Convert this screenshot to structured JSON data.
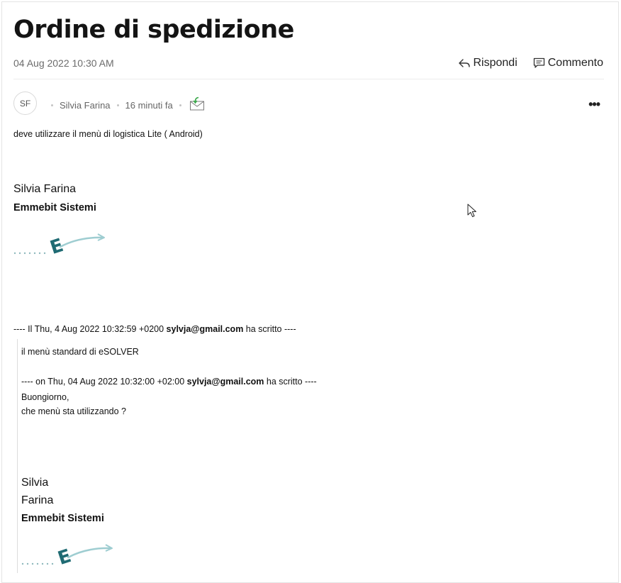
{
  "ticket": {
    "title": "Ordine di spedizione",
    "date": "04 Aug 2022 10:30 AM",
    "actions": {
      "reply": "Rispondi",
      "comment": "Commento"
    }
  },
  "message": {
    "avatar_initials": "SF",
    "author": "Silvia Farina",
    "time_ago": "16 minuti fa",
    "channel_icon": "email-incoming-icon",
    "more_label": "•••",
    "body": "deve utilizzare il menù di logistica Lite ( Android)",
    "signature": {
      "name": "Silvia Farina",
      "company": "Emmebit Sistemi",
      "logo_letter": "E"
    },
    "quote1": {
      "header_prefix": "---- Il  Thu, 4 Aug 2022 10:32:59 +0200 ",
      "email": "sylvja@gmail.com",
      "header_suffix": "  ha scritto ----",
      "body": "il menù standard di eSOLVER",
      "quote2": {
        "header_prefix": "---- on Thu, 04 Aug 2022 10:32:00 +02:00 ",
        "email": "sylvja@gmail.com",
        "header_suffix": "  ha scritto ----",
        "line1": "Buongiorno,",
        "line2": "che menù sta utilizzando ?"
      },
      "signature": {
        "first": "Silvia",
        "last": "Farina",
        "company": "Emmebit Sistemi",
        "logo_letter": "E"
      }
    }
  },
  "colors": {
    "logo_teal": "#1f6b73",
    "logo_light": "#9ecdd1",
    "email_icon_green": "#3aa84a"
  }
}
